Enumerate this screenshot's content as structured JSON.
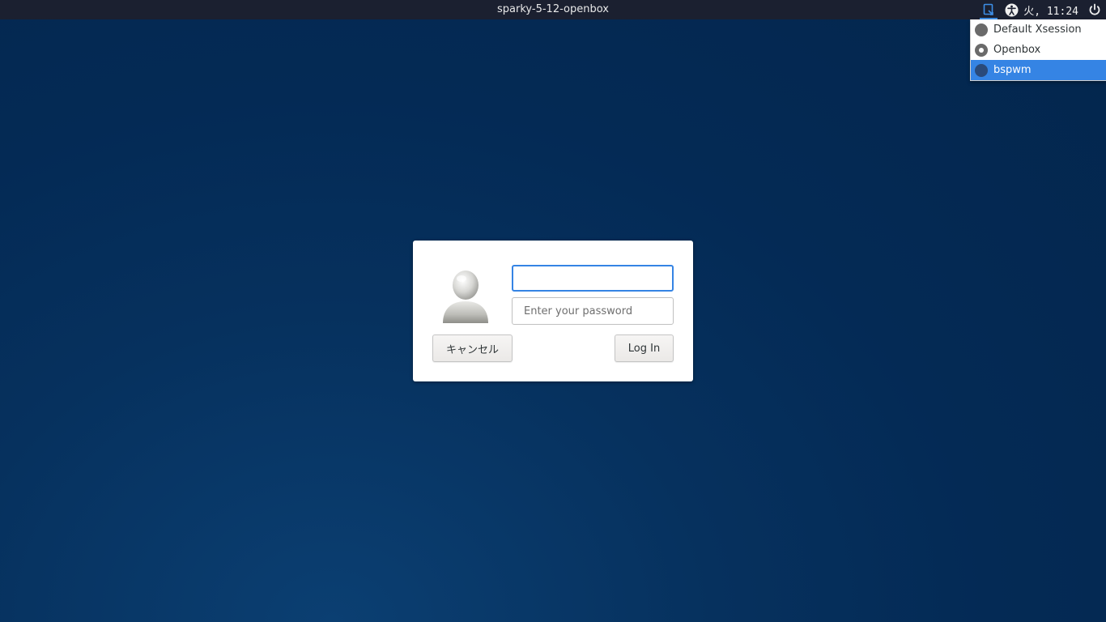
{
  "panel": {
    "hostname": "sparky-5-12-openbox",
    "clock": "火, 11:24",
    "icons": [
      "session-icon",
      "accessibility-icon",
      "power-icon"
    ]
  },
  "session_menu": {
    "items": [
      {
        "label": "Default Xsession",
        "state": "unchecked"
      },
      {
        "label": "Openbox",
        "state": "checked"
      },
      {
        "label": "bspwm",
        "state": "highlighted"
      }
    ]
  },
  "login": {
    "username_value": "",
    "password_placeholder": "Enter your password",
    "cancel_label": "キャンセル",
    "login_label": "Log In",
    "avatar_icon": "default-user-avatar"
  },
  "colors": {
    "accent": "#3584e4",
    "panel_bg": "#1b2030",
    "desktop_bg": "#06315e"
  }
}
